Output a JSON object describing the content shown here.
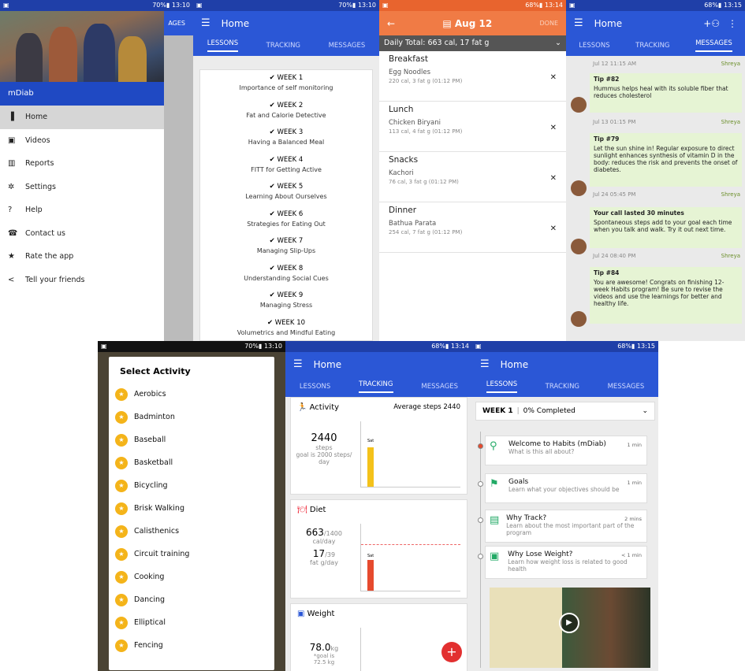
{
  "status": {
    "s1": "70%▮ 13:10",
    "s2": "70%▮ 13:10",
    "s3": "68%▮ 13:14",
    "s4": "68%▮ 13:15",
    "s5": "70%▮ 13:10",
    "s6": "68%▮ 13:14",
    "s7": "68%▮ 13:15"
  },
  "drawer": {
    "brand": "mDiab",
    "items": [
      {
        "label": "Home",
        "icon": "bars-icon"
      },
      {
        "label": "Videos",
        "icon": "video-icon"
      },
      {
        "label": "Reports",
        "icon": "reports-icon"
      },
      {
        "label": "Settings",
        "icon": "gear-icon"
      },
      {
        "label": "Help",
        "icon": "help-icon"
      },
      {
        "label": "Contact us",
        "icon": "phone-icon"
      },
      {
        "label": "Rate the app",
        "icon": "star-icon"
      },
      {
        "label": "Tell your friends",
        "icon": "share-icon"
      }
    ]
  },
  "home": {
    "title": "Home",
    "tabs": [
      "LESSONS",
      "TRACKING",
      "MESSAGES"
    ]
  },
  "weeks": [
    {
      "w": "WEEK 1",
      "t": "Importance of self monitoring"
    },
    {
      "w": "WEEK 2",
      "t": "Fat and Calorie Detective"
    },
    {
      "w": "WEEK 3",
      "t": "Having a Balanced Meal"
    },
    {
      "w": "WEEK 4",
      "t": "FITT for Getting Active"
    },
    {
      "w": "WEEK 5",
      "t": "Learning About Ourselves"
    },
    {
      "w": "WEEK 6",
      "t": "Strategies for Eating Out"
    },
    {
      "w": "WEEK 7",
      "t": "Managing Slip-Ups"
    },
    {
      "w": "WEEK 8",
      "t": "Understanding Social Cues"
    },
    {
      "w": "WEEK 9",
      "t": "Managing Stress"
    },
    {
      "w": "WEEK 10",
      "t": "Volumetrics and Mindful Eating"
    }
  ],
  "diet": {
    "date": "Aug 12",
    "done": "DONE",
    "total": "Daily Total: 663 cal, 17 fat g",
    "meals": [
      {
        "title": "Breakfast",
        "item": "Egg Noodles",
        "cal": "220 cal, 3 fat g (01:12 PM)"
      },
      {
        "title": "Lunch",
        "item": "Chicken Biryani",
        "cal": "113 cal, 4 fat g (01:12 PM)"
      },
      {
        "title": "Snacks",
        "item": "Kachori",
        "cal": "76 cal, 3 fat g (01:12 PM)"
      },
      {
        "title": "Dinner",
        "item": "Bathua Parata",
        "cal": "254 cal, 7 fat g (01:12 PM)"
      }
    ]
  },
  "messages": {
    "m": [
      {
        "stamp": "Jul 12 11:15 AM",
        "who": "Shreya",
        "title": "Tip #82",
        "body": "Hummus helps heal with its soluble fiber that reduces cholesterol"
      },
      {
        "stamp": "Jul 13 01:15 PM",
        "who": "Shreya",
        "title": "Tip #79",
        "body": "Let the sun shine in! Regular exposure to direct sunlight enhances synthesis of vitamin D in the body: reduces the risk and prevents the onset of diabetes."
      },
      {
        "stamp": "Jul 24 05:45 PM",
        "who": "Shreya",
        "title": "Your call lasted 30 minutes",
        "body": "Spontaneous steps add to your goal each time when you talk and walk. Try it out next time."
      },
      {
        "stamp": "Jul 24 08:40 PM",
        "who": "Shreya",
        "title": "Tip #84",
        "body": "You are awesome! Congrats on finishing 12-week Habits program! Be sure to revise the videos and use the learnings for better and healthy life."
      }
    ]
  },
  "activity": {
    "title": "Select Activity",
    "items": [
      "Aerobics",
      "Badminton",
      "Baseball",
      "Basketball",
      "Bicycling",
      "Brisk Walking",
      "Calisthenics",
      "Circuit training",
      "Cooking",
      "Dancing",
      "Elliptical",
      "Fencing"
    ]
  },
  "tracking": {
    "act_title": "Activity",
    "avg": "Average steps 2440",
    "steps": "2440",
    "steps_unit": "steps",
    "goal": "goal is 2000 steps/ day",
    "sat": "Sat",
    "diet_title": "Diet",
    "cal": "663",
    "cal_max": "/1400",
    "cal_unit": "cal/day",
    "fat": "17",
    "fat_max": "/39",
    "fat_unit": "fat g/day",
    "weight_title": "Weight",
    "weight": "78.0",
    "weight_unit": "kg",
    "weight_goal": "*goal is 72.5 kg",
    "steps_fill": 0.6,
    "diet_fill": 0.45,
    "fab": "+"
  },
  "lessons": {
    "week": "WEEK 1",
    "progress": "0% Completed",
    "items": [
      {
        "t1": "Welcome to Habits (mDiab)",
        "t2": "What is this all about?",
        "mn": "1 min"
      },
      {
        "t1": "Goals",
        "t2": "Learn what your objectives should be",
        "mn": "1 min"
      },
      {
        "t1": "Why Track?",
        "t2": "Learn about the most important part of the program",
        "mn": "2 mins"
      },
      {
        "t1": "Why Lose Weight?",
        "t2": "Learn how weight loss is related to good health",
        "mn": "< 1 min"
      }
    ]
  }
}
